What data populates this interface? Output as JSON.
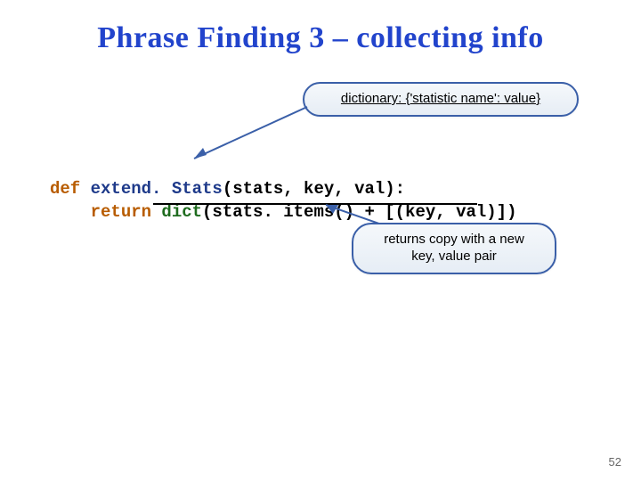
{
  "title": "Phrase Finding 3 – collecting info",
  "callouts": {
    "top": "dictionary: {'statistic name': value}",
    "bottom": "returns copy with a new key, value pair"
  },
  "code": {
    "def": "def ",
    "fn": "extend. Stats",
    "sig": "(stats, key, val):",
    "ret": "    return ",
    "builtin": "dict",
    "body": "(stats. items() + [(key, val)])"
  },
  "page": "52"
}
